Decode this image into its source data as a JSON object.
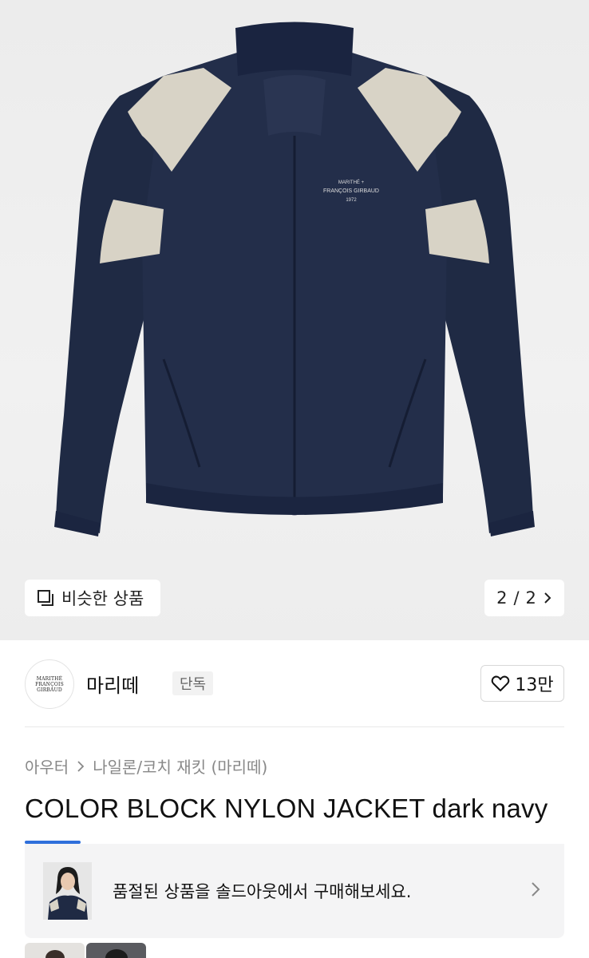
{
  "gallery": {
    "similar_button_label": "비슷한 상품",
    "page_current": "2",
    "page_separator": "/",
    "page_total": "2"
  },
  "product_image": {
    "chest_print_line1": "MARITHÉ +",
    "chest_print_line2": "FRANÇOIS GIRBAUD",
    "chest_print_line3": "1972",
    "body_color": "#1f2a44",
    "panel_color": "#d8d3c6"
  },
  "brand": {
    "logo_line1": "MARITHÉ",
    "logo_line2": "FRANÇOIS",
    "logo_line3": "GIRBAUD",
    "name": "마리떼",
    "badge": "단독",
    "like_count": "13만"
  },
  "category": {
    "level1": "아우터",
    "level2": "나일론/코치 재킷 (마리떼)"
  },
  "product": {
    "title": "COLOR BLOCK NYLON JACKET dark navy"
  },
  "soldout_banner": {
    "text": "품절된 상품을 솔드아웃에서 구매해보세요.",
    "accent_color": "#2f6fdb"
  }
}
